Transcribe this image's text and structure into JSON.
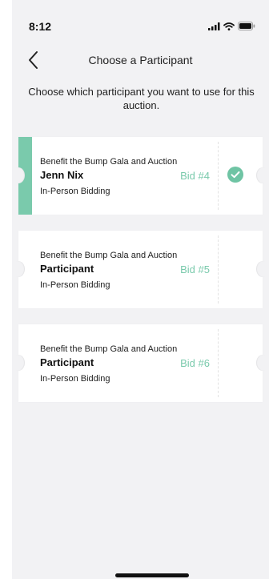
{
  "status": {
    "time": "8:12"
  },
  "nav": {
    "title": "Choose a Participant",
    "back_icon": "chevron-left-icon"
  },
  "subtitle": "Choose which participant you want to use for this auction.",
  "colors": {
    "accent": "#7acaac",
    "background": "#f2f2f4",
    "card": "#ffffff"
  },
  "participants": [
    {
      "event": "Benefit the Bump Gala and Auction",
      "name": "Jenn Nix",
      "bid": "Bid #4",
      "mode": "In-Person Bidding",
      "selected": true
    },
    {
      "event": "Benefit the Bump Gala and Auction",
      "name": "Participant",
      "bid": "Bid #5",
      "mode": "In-Person Bidding",
      "selected": false
    },
    {
      "event": "Benefit the Bump Gala and Auction",
      "name": "Participant",
      "bid": "Bid #6",
      "mode": "In-Person Bidding",
      "selected": false
    }
  ]
}
